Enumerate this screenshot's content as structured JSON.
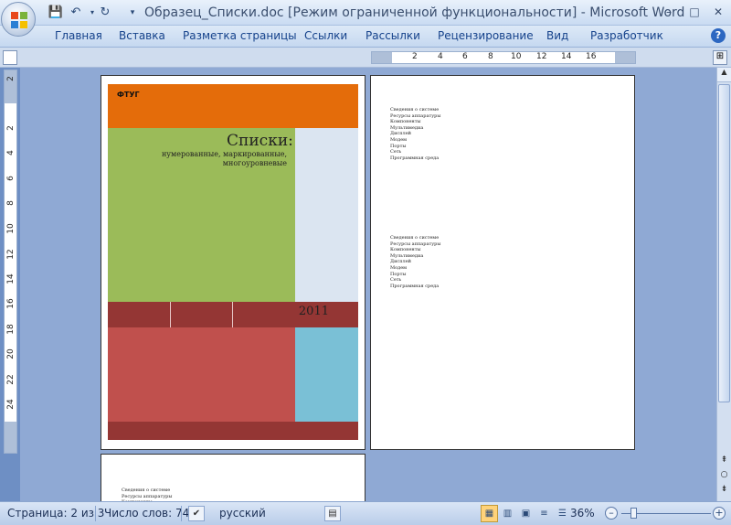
{
  "window": {
    "title": "Образец_Списки.doc [Режим ограниченной функциональности] - Microsoft Word",
    "minimize": "–",
    "maximize": "□",
    "close": "✕"
  },
  "quick_access": {
    "save_icon": "save-icon",
    "undo_icon": "undo-icon",
    "redo_icon": "redo-icon"
  },
  "ribbon": {
    "tabs": [
      "Главная",
      "Вставка",
      "Разметка страницы",
      "Ссылки",
      "Рассылки",
      "Рецензирование",
      "Вид",
      "Разработчик"
    ],
    "help": "?"
  },
  "ruler": {
    "h_ticks": [
      "2",
      "4",
      "6",
      "8",
      "10",
      "12",
      "14",
      "16"
    ],
    "v_ticks": [
      "2",
      "2",
      "4",
      "6",
      "8",
      "10",
      "12",
      "14",
      "16",
      "18",
      "20",
      "22",
      "24"
    ]
  },
  "cover": {
    "org": "ФТУГ",
    "title": "Списки:",
    "subtitle": "нумерованные, маркированные, многоуровневые",
    "year": "2011",
    "colors": {
      "orange": "#e46c0a",
      "green": "#9bbb59",
      "lightblue": "#dbe5f1",
      "darkred": "#943634",
      "red": "#c0504d",
      "cyan": "#7ac0d6"
    }
  },
  "toc": {
    "lines": [
      "Сведения о системе",
      "Ресурсы аппаратуры",
      "Компоненты",
      "Мультимедиа",
      "Дисплей",
      "Модем",
      "Порты",
      "Сеть",
      "Программная среда"
    ]
  },
  "status": {
    "page": "Страница: 2 из 3",
    "words": "Число слов: 74",
    "language": "русский",
    "zoom": "36%"
  }
}
